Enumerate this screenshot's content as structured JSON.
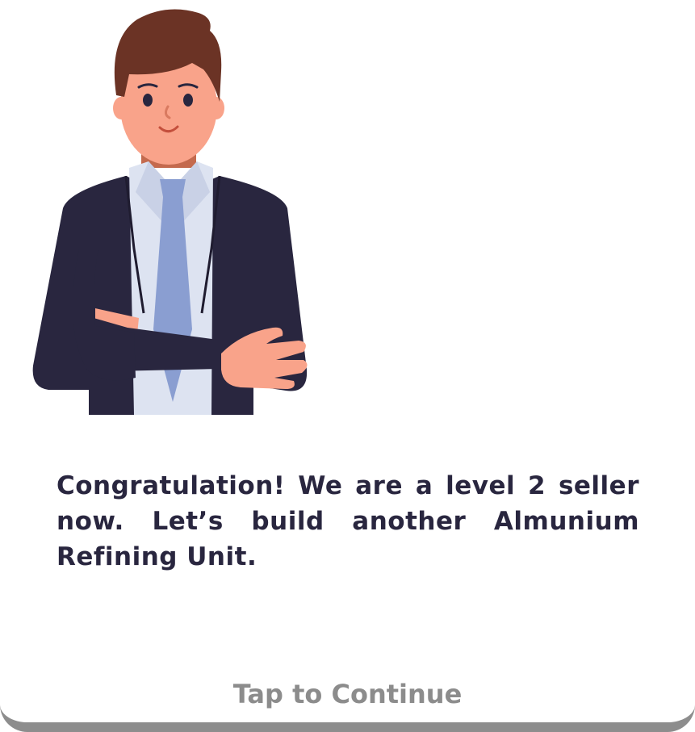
{
  "dialog": {
    "message": "Congratulation! We are a level 2 seller now. Let’s build another Almunium Refining Unit.",
    "continue_label": "Tap to Continue"
  },
  "colors": {
    "text": "#29263f",
    "continue_text": "#8c8c8c",
    "card_shadow": "#8d8d8d",
    "suit": "#29263f",
    "shirt": "#dde3f1",
    "tie": "#8a9ed1",
    "skin": "#f9a38a",
    "hair": "#6b3325"
  },
  "icons": {
    "character": "businessman-arms-crossed-icon"
  }
}
